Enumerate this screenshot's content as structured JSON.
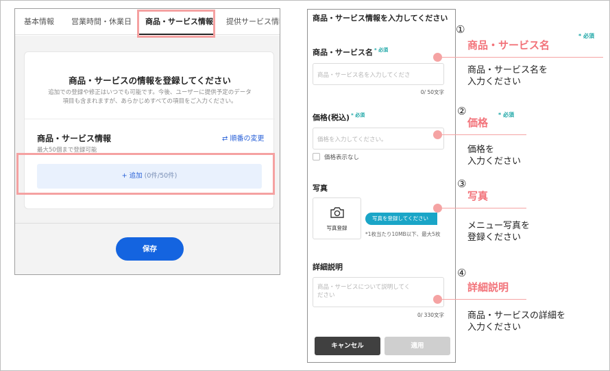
{
  "left_panel": {
    "tabs": [
      "基本情報",
      "営業時間・休業日",
      "商品・サービス情報",
      "提供サービス情報"
    ],
    "card": {
      "title": "商品・サービスの情報を登録してください",
      "desc_line1": "追加での登録や修正はいつでも可能です。今後、ユーザーに提供予定のデータ",
      "desc_line2": "項目も含まれますが、あらかじめすべての項目をご入力ください。",
      "section_title": "商品・サービス情報",
      "reorder_label": "⇄ 順番の変更",
      "limit_note": "最大50個まで登録可能",
      "add_label": "+ 追加",
      "add_count": "(0件/50件)"
    },
    "save_label": "保存"
  },
  "modal": {
    "title": "商品・サービス情報を入力してください",
    "name": {
      "label": "商品・サービス名",
      "required": "* 必須",
      "placeholder": "商品・サービス名を入力してくださ",
      "counter": "0/ 50文字"
    },
    "price": {
      "label": "価格(税込)",
      "required": "* 必須",
      "placeholder": "価格を入力してください。",
      "hide_label": "価格表示なし"
    },
    "photo": {
      "label": "写真",
      "upload_label": "写真登録",
      "tip": "写真を登録してください",
      "note": "*1枚当たり10MB以下、最大5枚"
    },
    "detail": {
      "label": "詳細説明",
      "placeholder_line1": "商品・サービスについて説明してく",
      "placeholder_line2": "ださい",
      "counter": "0/ 330文字"
    },
    "cancel_label": "キャンセル",
    "apply_label": "適用"
  },
  "annotations": [
    {
      "num": "①",
      "title": "商品・サービス名",
      "req": "* 必須",
      "desc1": "商品・サービス名を",
      "desc2": "入力ください"
    },
    {
      "num": "②",
      "title": "価格",
      "req": "* 必須",
      "desc1": "価格を",
      "desc2": "入力ください"
    },
    {
      "num": "③",
      "title": "写真",
      "req": "",
      "desc1": "メニュー写真を",
      "desc2": "登録ください"
    },
    {
      "num": "④",
      "title": "詳細説明",
      "req": "",
      "desc1": "商品・サービスの詳細を",
      "desc2": "入力ください"
    }
  ],
  "colors": {
    "highlight": "#f5a1a1",
    "accent_blue": "#1464e0",
    "required_teal": "#1aa5a5",
    "annotation_title": "#f2737a"
  }
}
